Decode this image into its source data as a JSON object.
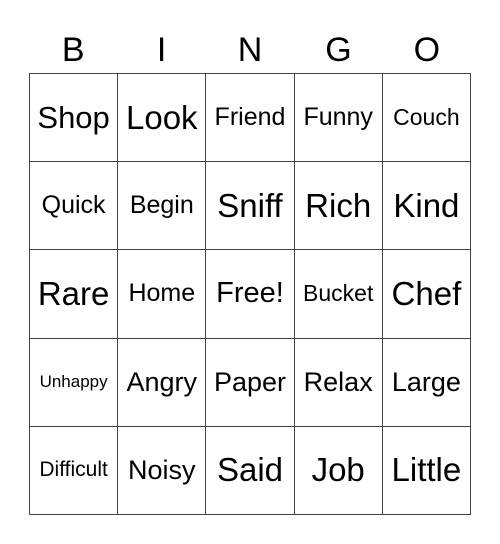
{
  "header": [
    "B",
    "I",
    "N",
    "G",
    "O"
  ],
  "cells": [
    {
      "text": "Shop",
      "size": 31
    },
    {
      "text": "Look",
      "size": 33
    },
    {
      "text": "Friend",
      "size": 25
    },
    {
      "text": "Funny",
      "size": 25
    },
    {
      "text": "Couch",
      "size": 23
    },
    {
      "text": "Quick",
      "size": 25
    },
    {
      "text": "Begin",
      "size": 25
    },
    {
      "text": "Sniff",
      "size": 33
    },
    {
      "text": "Rich",
      "size": 33
    },
    {
      "text": "Kind",
      "size": 33
    },
    {
      "text": "Rare",
      "size": 33
    },
    {
      "text": "Home",
      "size": 25
    },
    {
      "text": "Free!",
      "size": 29
    },
    {
      "text": "Bucket",
      "size": 23
    },
    {
      "text": "Chef",
      "size": 33
    },
    {
      "text": "Unhappy",
      "size": 17
    },
    {
      "text": "Angry",
      "size": 27
    },
    {
      "text": "Paper",
      "size": 27
    },
    {
      "text": "Relax",
      "size": 27
    },
    {
      "text": "Large",
      "size": 27
    },
    {
      "text": "Difficult",
      "size": 21
    },
    {
      "text": "Noisy",
      "size": 27
    },
    {
      "text": "Said",
      "size": 33
    },
    {
      "text": "Job",
      "size": 33
    },
    {
      "text": "Little",
      "size": 33
    }
  ]
}
